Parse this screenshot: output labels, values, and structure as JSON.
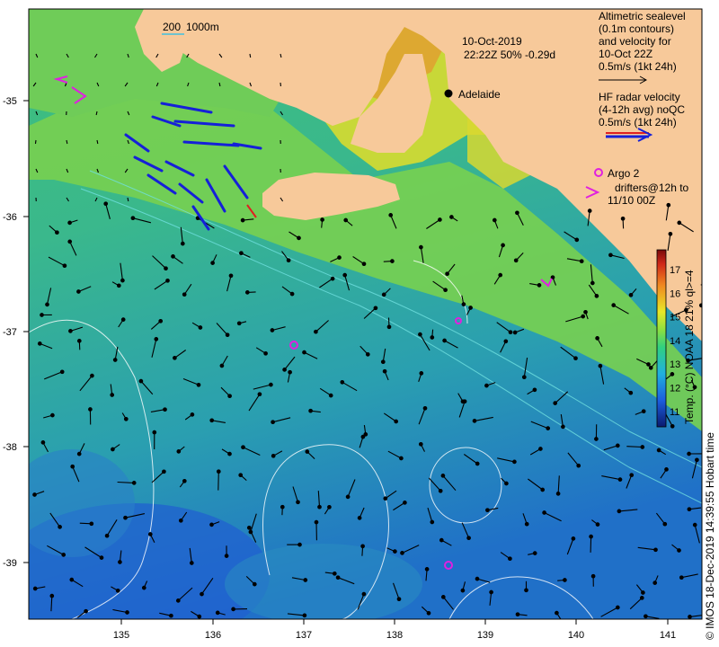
{
  "title": {
    "date": "10-Oct-2019",
    "time_info": "22:22Z  50% -0.29d"
  },
  "scale_bar": {
    "label_a": "200",
    "label_b": "1000m"
  },
  "city": {
    "name": "Adelaide"
  },
  "legend": {
    "altimetric": [
      "Altimetric sealevel",
      "(0.1m contours)",
      "and velocity for",
      "10-Oct 22Z",
      "0.5m/s (1kt 24h)"
    ],
    "hf_radar": [
      "HF radar velocity",
      "(4-12h avg) noQC",
      "0.5m/s (1kt 24h)"
    ],
    "argo": [
      "Argo 2",
      "drifters@12h to",
      "11/10 00Z"
    ]
  },
  "axes": {
    "x_ticks": [
      "135",
      "136",
      "137",
      "138",
      "139",
      "140",
      "141"
    ],
    "y_ticks": [
      "-35",
      "-36",
      "-37",
      "-38",
      "-39"
    ]
  },
  "colorbar": {
    "ticks": [
      "11",
      "12",
      "13",
      "14",
      "15",
      "16",
      "17"
    ],
    "label": "Temp. (°C) NOAA 18 21% ql>=4"
  },
  "credit": "© IMOS 18-Dec-2019 14:39:55 Hobart time",
  "colors": {
    "land": "#f7c99a",
    "shelf": "#7fd64a",
    "deep": "#3cb48a",
    "hf_blue": "#1520d8",
    "argo": "#e020e0"
  }
}
